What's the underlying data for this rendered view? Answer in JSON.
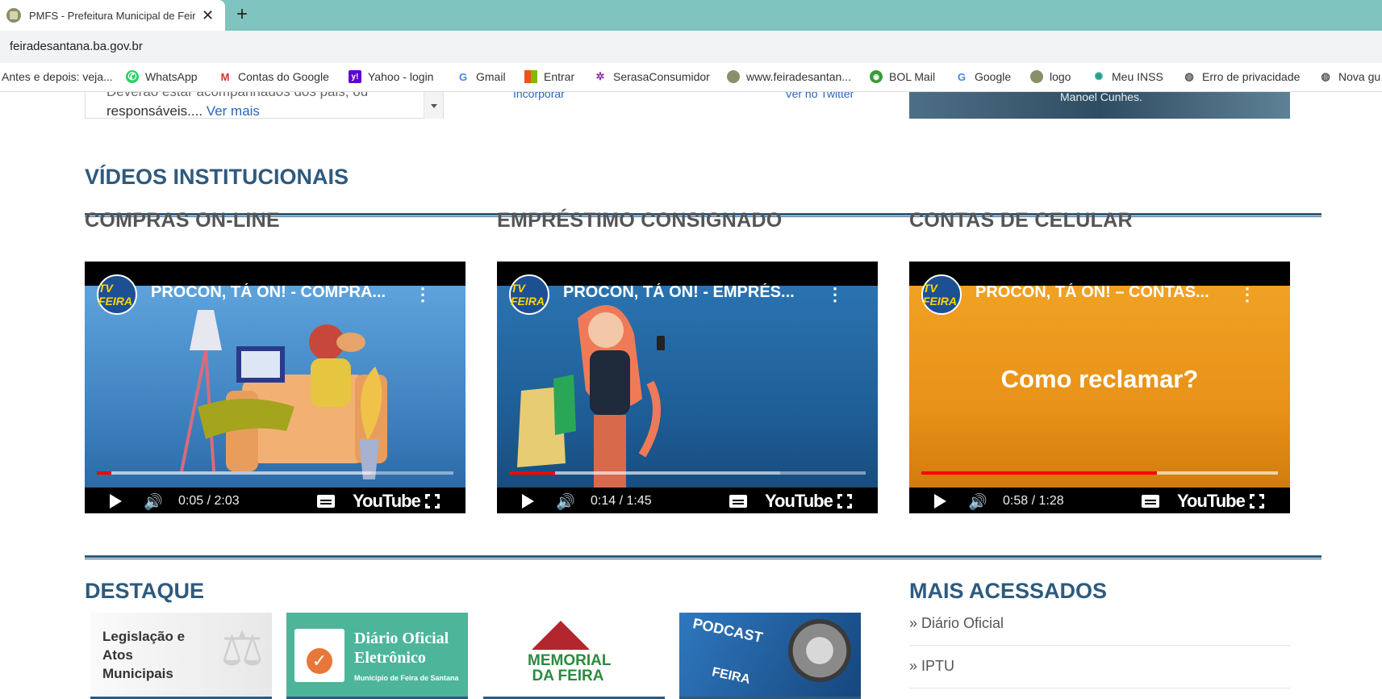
{
  "browser": {
    "tab_title": "PMFS - Prefeitura Municipal de Feira de Santana",
    "url": "feiradesantana.ba.gov.br",
    "bookmarks": [
      {
        "label": "Antes e depois: veja...",
        "icon": "none"
      },
      {
        "label": "WhatsApp",
        "icon": "whatsapp-icon"
      },
      {
        "label": "Contas do Google",
        "icon": "gmail-icon"
      },
      {
        "label": "Yahoo - login",
        "icon": "yahoo-icon"
      },
      {
        "label": "Gmail",
        "icon": "google-icon"
      },
      {
        "label": "Entrar",
        "icon": "microsoft-icon"
      },
      {
        "label": "SerasaConsumidor",
        "icon": "serasa-icon"
      },
      {
        "label": "www.feiradesantan...",
        "icon": "site-icon"
      },
      {
        "label": "BOL Mail",
        "icon": "bol-icon"
      },
      {
        "label": "Google",
        "icon": "google-icon"
      },
      {
        "label": "logo",
        "icon": "site-icon"
      },
      {
        "label": "Meu INSS",
        "icon": "inss-icon"
      },
      {
        "label": "Erro de privacidade",
        "icon": "globe-icon"
      },
      {
        "label": "Nova gu",
        "icon": "globe-icon"
      }
    ]
  },
  "top_fragment": {
    "left_text_line1": "Deverão estar acompanhados dos pais, ou",
    "left_text_line2": "responsáveis....",
    "ver_mais": "Ver mais",
    "incorporar": "Incorporar",
    "ver_twitter": "Ver no Twitter",
    "image_caption": "Manoel Cunhes."
  },
  "videos_section": {
    "heading": "VÍDEOS INSTITUCIONAIS",
    "videos": [
      {
        "heading": "COMPRAS ON-LINE",
        "title": "PROCON, TÁ ON! - COMPRA...",
        "time": "0:05 / 2:03",
        "progress": 0.04,
        "buffered": 0.77,
        "theme": "blue"
      },
      {
        "heading": "EMPRÉSTIMO CONSIGNADO",
        "title": "PROCON, TÁ ON! - EMPRÉS...",
        "time": "0:14 / 1:45",
        "progress": 0.13,
        "buffered": 0.76,
        "theme": "blue2"
      },
      {
        "heading": "CONTAS DE CELULAR",
        "title": "PROCON, TÁ ON! – CONTAS...",
        "time": "0:58 / 1:28",
        "progress": 0.66,
        "buffered": 1.0,
        "theme": "orange",
        "overlay_text": "Como reclamar?"
      }
    ],
    "channel_badge": "TV FEIRA",
    "youtube_label": "YouTube"
  },
  "destaque": {
    "heading": "DESTAQUE",
    "cards": [
      {
        "text": "Legislação e Atos Municipais"
      },
      {
        "text": "Diário Oficial Eletrônico",
        "sub": "Município de Feira de Santana"
      },
      {
        "text": "MEMORIAL DA FEIRA"
      },
      {
        "text": "PODCAST",
        "sub": "FEIRA"
      }
    ]
  },
  "mais_acessados": {
    "heading": "MAIS ACESSADOS",
    "items": [
      "» Diário Oficial",
      "» IPTU"
    ]
  },
  "colors": {
    "brand": "#2e5a7e",
    "tabbar": "#7fc4be",
    "link": "#2a66b8"
  }
}
